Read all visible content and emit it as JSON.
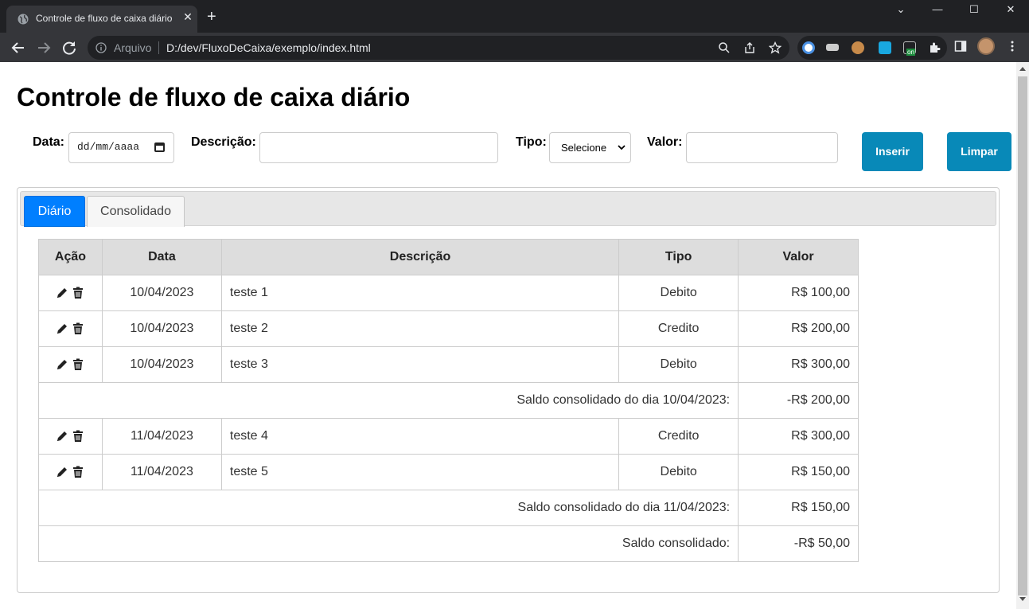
{
  "browser": {
    "tab_title": "Controle de fluxo de caixa diário",
    "address_scheme": "Arquivo",
    "address_url": "D:/dev/FluxoDeCaixa/exemplo/index.html",
    "ext_badge": "on"
  },
  "page": {
    "title": "Controle de fluxo de caixa diário"
  },
  "form": {
    "data_label": "Data:",
    "data_placeholder": "dd/mm/aaaa",
    "descricao_label": "Descrição:",
    "descricao_value": "",
    "tipo_label": "Tipo:",
    "tipo_selected": "Selecione",
    "valor_label": "Valor:",
    "valor_value": "",
    "inserir_label": "Inserir",
    "limpar_label": "Limpar"
  },
  "tabs": [
    {
      "label": "Diário",
      "active": true
    },
    {
      "label": "Consolidado",
      "active": false
    }
  ],
  "table": {
    "headers": [
      "Ação",
      "Data",
      "Descrição",
      "Tipo",
      "Valor"
    ],
    "rows": [
      {
        "kind": "entry",
        "data": "10/04/2023",
        "descricao": "teste 1",
        "tipo": "Debito",
        "valor": "R$ 100,00"
      },
      {
        "kind": "entry",
        "data": "10/04/2023",
        "descricao": "teste 2",
        "tipo": "Credito",
        "valor": "R$ 200,00"
      },
      {
        "kind": "entry",
        "data": "10/04/2023",
        "descricao": "teste 3",
        "tipo": "Debito",
        "valor": "R$ 300,00"
      },
      {
        "kind": "summary",
        "label": "Saldo consolidado do dia 10/04/2023:",
        "valor": "-R$ 200,00"
      },
      {
        "kind": "entry",
        "data": "11/04/2023",
        "descricao": "teste 4",
        "tipo": "Credito",
        "valor": "R$ 300,00"
      },
      {
        "kind": "entry",
        "data": "11/04/2023",
        "descricao": "teste 5",
        "tipo": "Debito",
        "valor": "R$ 150,00"
      },
      {
        "kind": "summary",
        "label": "Saldo consolidado do dia 11/04/2023:",
        "valor": "R$ 150,00"
      },
      {
        "kind": "summary",
        "label": "Saldo consolidado:",
        "valor": "-R$ 50,00"
      }
    ]
  },
  "colors": {
    "button": "#0889b8",
    "tab_active": "#007fff",
    "header_bg": "#dddddd",
    "chrome_dark": "#202124"
  }
}
